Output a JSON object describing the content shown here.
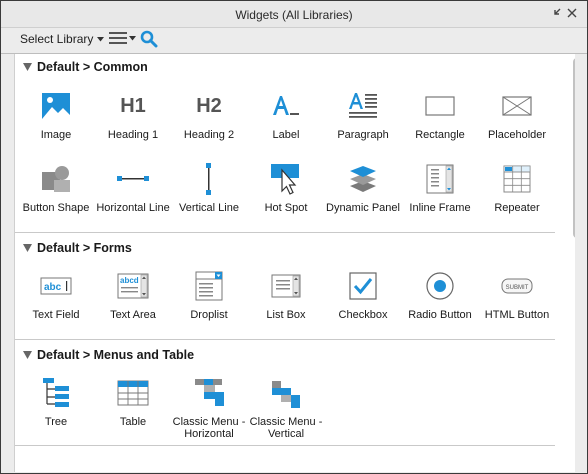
{
  "window": {
    "title": "Widgets (All Libraries)"
  },
  "toolbar": {
    "library_label": "Select Library"
  },
  "sections": [
    {
      "title": "Default > Common",
      "widgets": [
        {
          "label": "Image",
          "icon": "image-icon"
        },
        {
          "label": "Heading 1",
          "icon": "heading1-icon",
          "glyph": "H1"
        },
        {
          "label": "Heading 2",
          "icon": "heading2-icon",
          "glyph": "H2"
        },
        {
          "label": "Label",
          "icon": "label-icon"
        },
        {
          "label": "Paragraph",
          "icon": "paragraph-icon"
        },
        {
          "label": "Rectangle",
          "icon": "rectangle-icon"
        },
        {
          "label": "Placeholder",
          "icon": "placeholder-icon"
        },
        {
          "label": "Button Shape",
          "icon": "button-shape-icon"
        },
        {
          "label": "Horizontal Line",
          "icon": "horizontal-line-icon"
        },
        {
          "label": "Vertical Line",
          "icon": "vertical-line-icon"
        },
        {
          "label": "Hot Spot",
          "icon": "hot-spot-icon"
        },
        {
          "label": "Dynamic Panel",
          "icon": "dynamic-panel-icon"
        },
        {
          "label": "Inline Frame",
          "icon": "inline-frame-icon"
        },
        {
          "label": "Repeater",
          "icon": "repeater-icon"
        }
      ]
    },
    {
      "title": "Default > Forms",
      "widgets": [
        {
          "label": "Text Field",
          "icon": "text-field-icon",
          "glyph": "abc"
        },
        {
          "label": "Text Area",
          "icon": "text-area-icon",
          "glyph": "abcd"
        },
        {
          "label": "Droplist",
          "icon": "droplist-icon"
        },
        {
          "label": "List Box",
          "icon": "list-box-icon"
        },
        {
          "label": "Checkbox",
          "icon": "checkbox-icon"
        },
        {
          "label": "Radio Button",
          "icon": "radio-button-icon"
        },
        {
          "label": "HTML Button",
          "icon": "html-button-icon",
          "glyph": "SUBMIT"
        }
      ]
    },
    {
      "title": "Default > Menus and Table",
      "widgets": [
        {
          "label": "Tree",
          "icon": "tree-icon"
        },
        {
          "label": "Table",
          "icon": "table-icon"
        },
        {
          "label": "Classic Menu - Horizontal",
          "icon": "classic-menu-horizontal-icon"
        },
        {
          "label": "Classic Menu - Vertical",
          "icon": "classic-menu-vertical-icon"
        }
      ]
    }
  ],
  "colors": {
    "accent": "#1e8fd6",
    "icon_gray": "#8a8a8a"
  }
}
